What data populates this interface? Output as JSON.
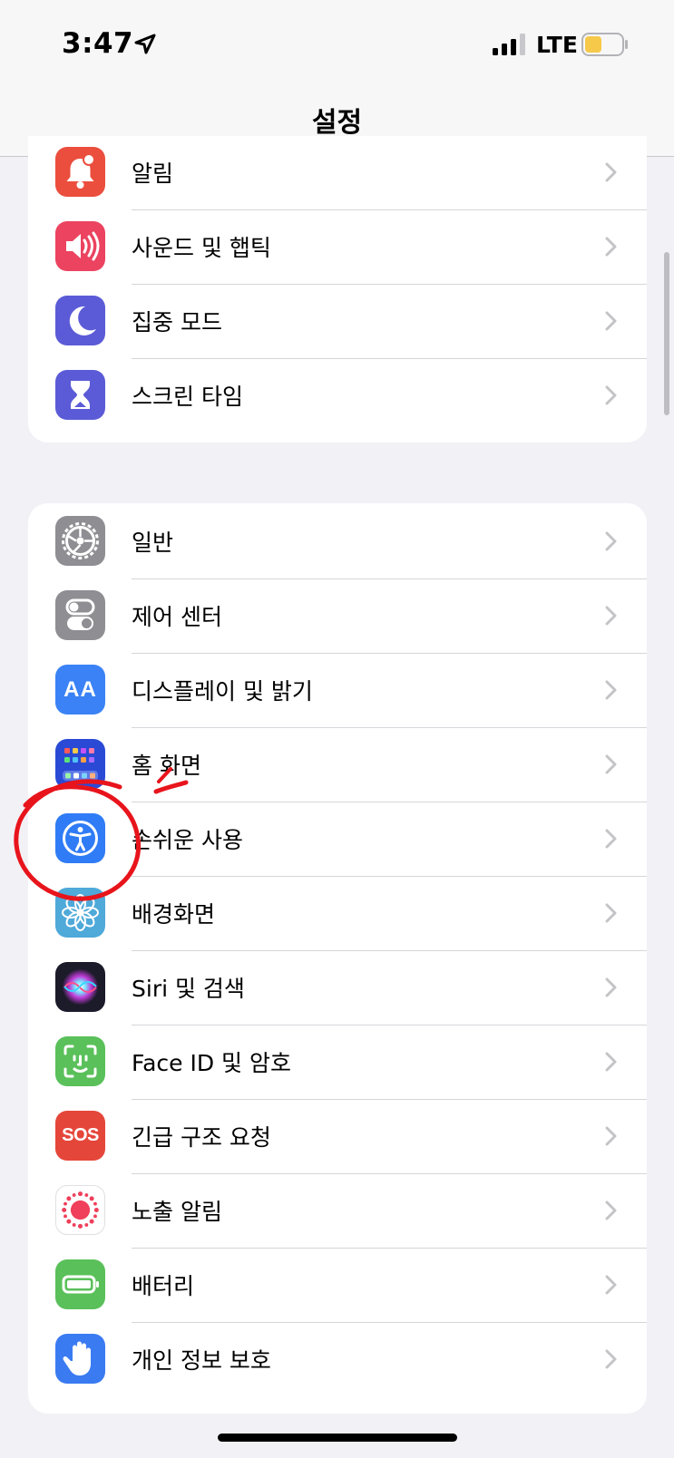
{
  "status_bar": {
    "time": "3:47",
    "network": "LTE",
    "battery_color": "#f6c94a"
  },
  "nav": {
    "title": "설정"
  },
  "group1": [
    {
      "label": "알림",
      "icon": "bell-icon",
      "color": "#eb4e3d"
    },
    {
      "label": "사운드 및 햅틱",
      "icon": "speaker-icon",
      "color": "#eb4360"
    },
    {
      "label": "집중 모드",
      "icon": "moon-icon",
      "color": "#5b5bd7"
    },
    {
      "label": "스크린 타임",
      "icon": "hourglass-icon",
      "color": "#5b5bd7"
    }
  ],
  "group2": [
    {
      "label": "일반",
      "icon": "gear-icon",
      "color": "#8e8e93"
    },
    {
      "label": "제어 센터",
      "icon": "toggles-icon",
      "color": "#8e8e93"
    },
    {
      "label": "디스플레이 및 밝기",
      "icon": "text-size-icon",
      "color": "#3a82f6",
      "glyph": "AA"
    },
    {
      "label": "홈 화면",
      "icon": "home-grid-icon",
      "color": "#2a4ad6"
    },
    {
      "label": "손쉬운 사용",
      "icon": "accessibility-icon",
      "color": "#2f7cf6"
    },
    {
      "label": "배경화면",
      "icon": "flower-icon",
      "color": "#4fa9d9"
    },
    {
      "label": "Siri 및 검색",
      "icon": "siri-icon",
      "color": "#1b1b2a"
    },
    {
      "label": "Face ID 및 암호",
      "icon": "face-id-icon",
      "color": "#5ac05a"
    },
    {
      "label": "긴급 구조 요청",
      "icon": "sos-icon",
      "color": "#e5463a",
      "glyph": "SOS"
    },
    {
      "label": "노출 알림",
      "icon": "exposure-icon",
      "color": "#ffffff"
    },
    {
      "label": "배터리",
      "icon": "battery-icon",
      "color": "#5ac05a"
    },
    {
      "label": "개인 정보 보호",
      "icon": "hand-icon",
      "color": "#3a7bf2"
    }
  ],
  "annotation_color": "#e8141c"
}
